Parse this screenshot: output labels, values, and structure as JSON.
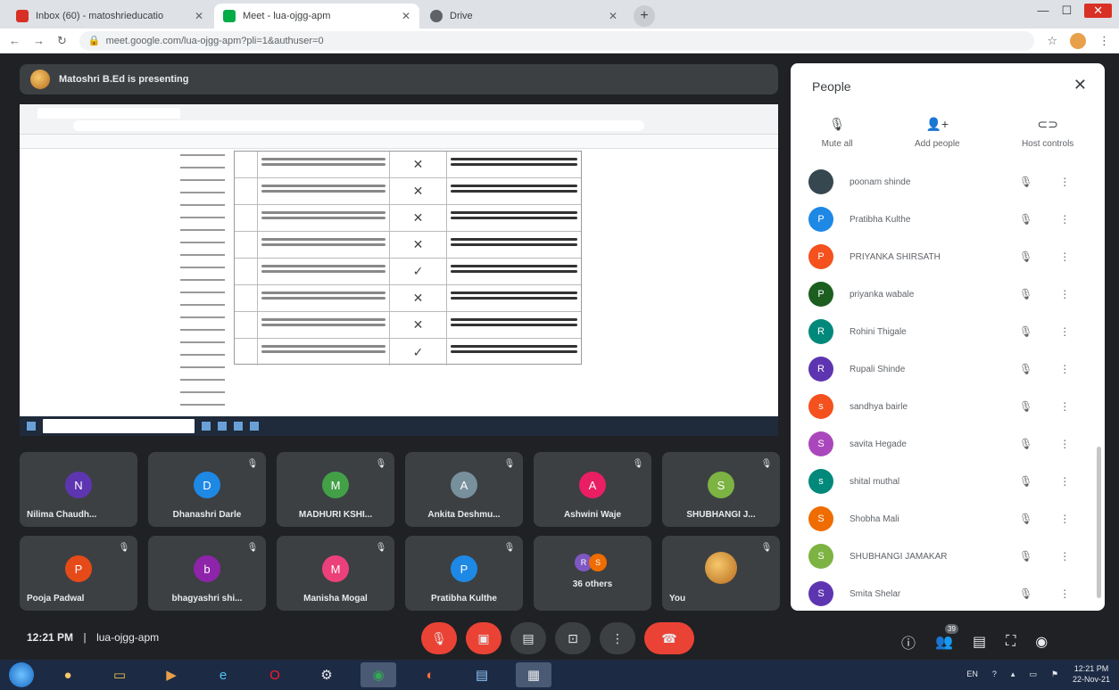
{
  "browser": {
    "tabs": [
      {
        "title": "Inbox (60) - matoshrieducatio",
        "favicon_color": "#d93025"
      },
      {
        "title": "Meet - lua-ojgg-apm",
        "favicon_color": "#00ac47"
      },
      {
        "title": "Drive",
        "favicon_color": "#5f6368"
      }
    ],
    "url": "meet.google.com/lua-ojgg-apm?pli=1&authuser=0"
  },
  "meet": {
    "presenting_label": "Matoshri B.Ed is presenting",
    "tiles_row1": [
      {
        "initial": "N",
        "name": "Nilima Chaudh...",
        "color": "#5e35b1"
      },
      {
        "initial": "D",
        "name": "Dhanashri Darle",
        "color": "#1e88e5"
      },
      {
        "initial": "M",
        "name": "MADHURI KSHI...",
        "color": "#43a047"
      },
      {
        "initial": "A",
        "name": "Ankita Deshmu...",
        "color": "#78909c"
      },
      {
        "initial": "A",
        "name": "Ashwini Waje",
        "color": "#e91e63"
      },
      {
        "initial": "S",
        "name": "SHUBHANGI J...",
        "color": "#7cb342"
      }
    ],
    "tiles_row2": [
      {
        "initial": "P",
        "name": "Pooja Padwal",
        "color": "#e64a19"
      },
      {
        "initial": "b",
        "name": "bhagyashri shi...",
        "color": "#8e24aa"
      },
      {
        "initial": "M",
        "name": "Manisha Mogal",
        "color": "#ec407a"
      },
      {
        "initial": "P",
        "name": "Pratibha Kulthe",
        "color": "#1e88e5"
      }
    ],
    "others_label": "36 others",
    "you_label": "You",
    "clock": "12:21 PM",
    "meeting_code": "lua-ojgg-apm",
    "people_count": "39"
  },
  "people_panel": {
    "title": "People",
    "actions": {
      "mute_all": "Mute all",
      "add_people": "Add people",
      "host_controls": "Host controls"
    },
    "participants": [
      {
        "initial": "",
        "name": "poonam shinde",
        "color": "#37474f"
      },
      {
        "initial": "P",
        "name": "Pratibha Kulthe",
        "color": "#1e88e5"
      },
      {
        "initial": "P",
        "name": "PRIYANKA SHIRSATH",
        "color": "#f4511e"
      },
      {
        "initial": "P",
        "name": "priyanka wabale",
        "color": "#1b5e20"
      },
      {
        "initial": "R",
        "name": "Rohini Thigale",
        "color": "#00897b"
      },
      {
        "initial": "R",
        "name": "Rupali Shinde",
        "color": "#5e35b1"
      },
      {
        "initial": "s",
        "name": "sandhya bairle",
        "color": "#f4511e"
      },
      {
        "initial": "S",
        "name": "savita Hegade",
        "color": "#ab47bc"
      },
      {
        "initial": "s",
        "name": "shital muthal",
        "color": "#00897b"
      },
      {
        "initial": "S",
        "name": "Shobha Mali",
        "color": "#ef6c00"
      },
      {
        "initial": "S",
        "name": "SHUBHANGI JAMAKAR",
        "color": "#7cb342"
      },
      {
        "initial": "S",
        "name": "Smita Shelar",
        "color": "#5e35b1"
      }
    ]
  },
  "windows": {
    "time": "12:21 PM",
    "date": "22-Nov-21",
    "lang": "EN"
  }
}
